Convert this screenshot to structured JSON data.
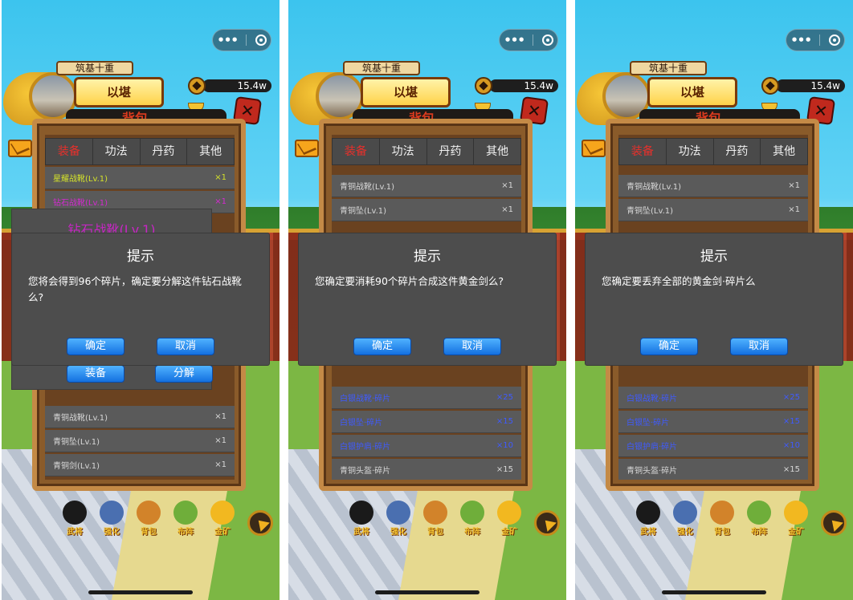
{
  "screens": [
    {
      "header": {
        "rank": "筑基十重",
        "name": "以堪",
        "gold": "15.4w",
        "panel_title": "背包",
        "close_icon": "close-icon"
      },
      "tabs": [
        {
          "label": "装备",
          "active": true
        },
        {
          "label": "功法"
        },
        {
          "label": "丹药"
        },
        {
          "label": "其他"
        }
      ],
      "top_rows": [
        {
          "name": "星耀战靴(Lv.1)",
          "qty": "×1",
          "color": "#d4e22a"
        },
        {
          "name": "钻石战靴(Lv.1)",
          "qty": "×1",
          "color": "#d42ad0"
        }
      ],
      "detail": {
        "title": "钻石战靴(Lv.1)",
        "equip_label": "装备",
        "decompose_label": "分解"
      },
      "bottom_rows": [
        {
          "name": "青铜战靴(Lv.1)",
          "qty": "×1",
          "color": "#d8d8d8"
        },
        {
          "name": "青铜坠(Lv.1)",
          "qty": "×1",
          "color": "#d8d8d8"
        },
        {
          "name": "青铜剑(Lv.1)",
          "qty": "×1",
          "color": "#d8d8d8"
        }
      ],
      "dialog": {
        "title": "提示",
        "message": "您将会得到96个碎片，确定要分解这件钻石战靴么?",
        "confirm": "确定",
        "cancel": "取消"
      }
    },
    {
      "header": {
        "rank": "筑基十重",
        "name": "以堪",
        "gold": "15.4w",
        "panel_title": "背包"
      },
      "tabs": [
        {
          "label": "装备",
          "active": true
        },
        {
          "label": "功法"
        },
        {
          "label": "丹药"
        },
        {
          "label": "其他"
        }
      ],
      "top_rows": [
        {
          "name": "青铜战靴(Lv.1)",
          "qty": "×1",
          "color": "#d8d8d8"
        },
        {
          "name": "青铜坠(Lv.1)",
          "qty": "×1",
          "color": "#d8d8d8"
        }
      ],
      "bottom_rows": [
        {
          "name": "白银战靴·碎片",
          "qty": "×25",
          "color": "#3f5bff"
        },
        {
          "name": "白银坠·碎片",
          "qty": "×15",
          "color": "#3f5bff"
        },
        {
          "name": "白银护肩·碎片",
          "qty": "×10",
          "color": "#3f5bff"
        },
        {
          "name": "青铜头盔·碎片",
          "qty": "×15",
          "color": "#d8d8d8"
        }
      ],
      "dialog": {
        "title": "提示",
        "message": "您确定要消耗90个碎片合成这件黄金剑么?",
        "confirm": "确定",
        "cancel": "取消"
      }
    },
    {
      "header": {
        "rank": "筑基十重",
        "name": "以堪",
        "gold": "15.4w",
        "panel_title": "背包"
      },
      "tabs": [
        {
          "label": "装备",
          "active": true
        },
        {
          "label": "功法"
        },
        {
          "label": "丹药"
        },
        {
          "label": "其他"
        }
      ],
      "top_rows": [
        {
          "name": "青铜战靴(Lv.1)",
          "qty": "×1",
          "color": "#d8d8d8"
        },
        {
          "name": "青铜坠(Lv.1)",
          "qty": "×1",
          "color": "#d8d8d8"
        }
      ],
      "bottom_rows": [
        {
          "name": "白银战靴·碎片",
          "qty": "×25",
          "color": "#3f5bff"
        },
        {
          "name": "白银坠·碎片",
          "qty": "×15",
          "color": "#3f5bff"
        },
        {
          "name": "白银护肩·碎片",
          "qty": "×10",
          "color": "#3f5bff"
        },
        {
          "name": "青铜头盔·碎片",
          "qty": "×15",
          "color": "#d8d8d8"
        }
      ],
      "dialog": {
        "title": "提示",
        "message": "您确定要丢弃全部的黄金剑·碎片么",
        "confirm": "确定",
        "cancel": "取消"
      }
    }
  ],
  "bottom_nav": [
    {
      "label": "武将",
      "icon": "warrior-icon",
      "color": "#1a1a1a"
    },
    {
      "label": "强化",
      "icon": "hammer-icon",
      "color": "#4a6fb0"
    },
    {
      "label": "背包",
      "icon": "bag-icon",
      "color": "#d2832a"
    },
    {
      "label": "布阵",
      "icon": "formation-icon",
      "color": "#6fae3a"
    },
    {
      "label": "金矿",
      "icon": "gold-mine-icon",
      "color": "#f2b820"
    }
  ],
  "capsule": {
    "more": "•••",
    "close": "close-circle-icon"
  }
}
